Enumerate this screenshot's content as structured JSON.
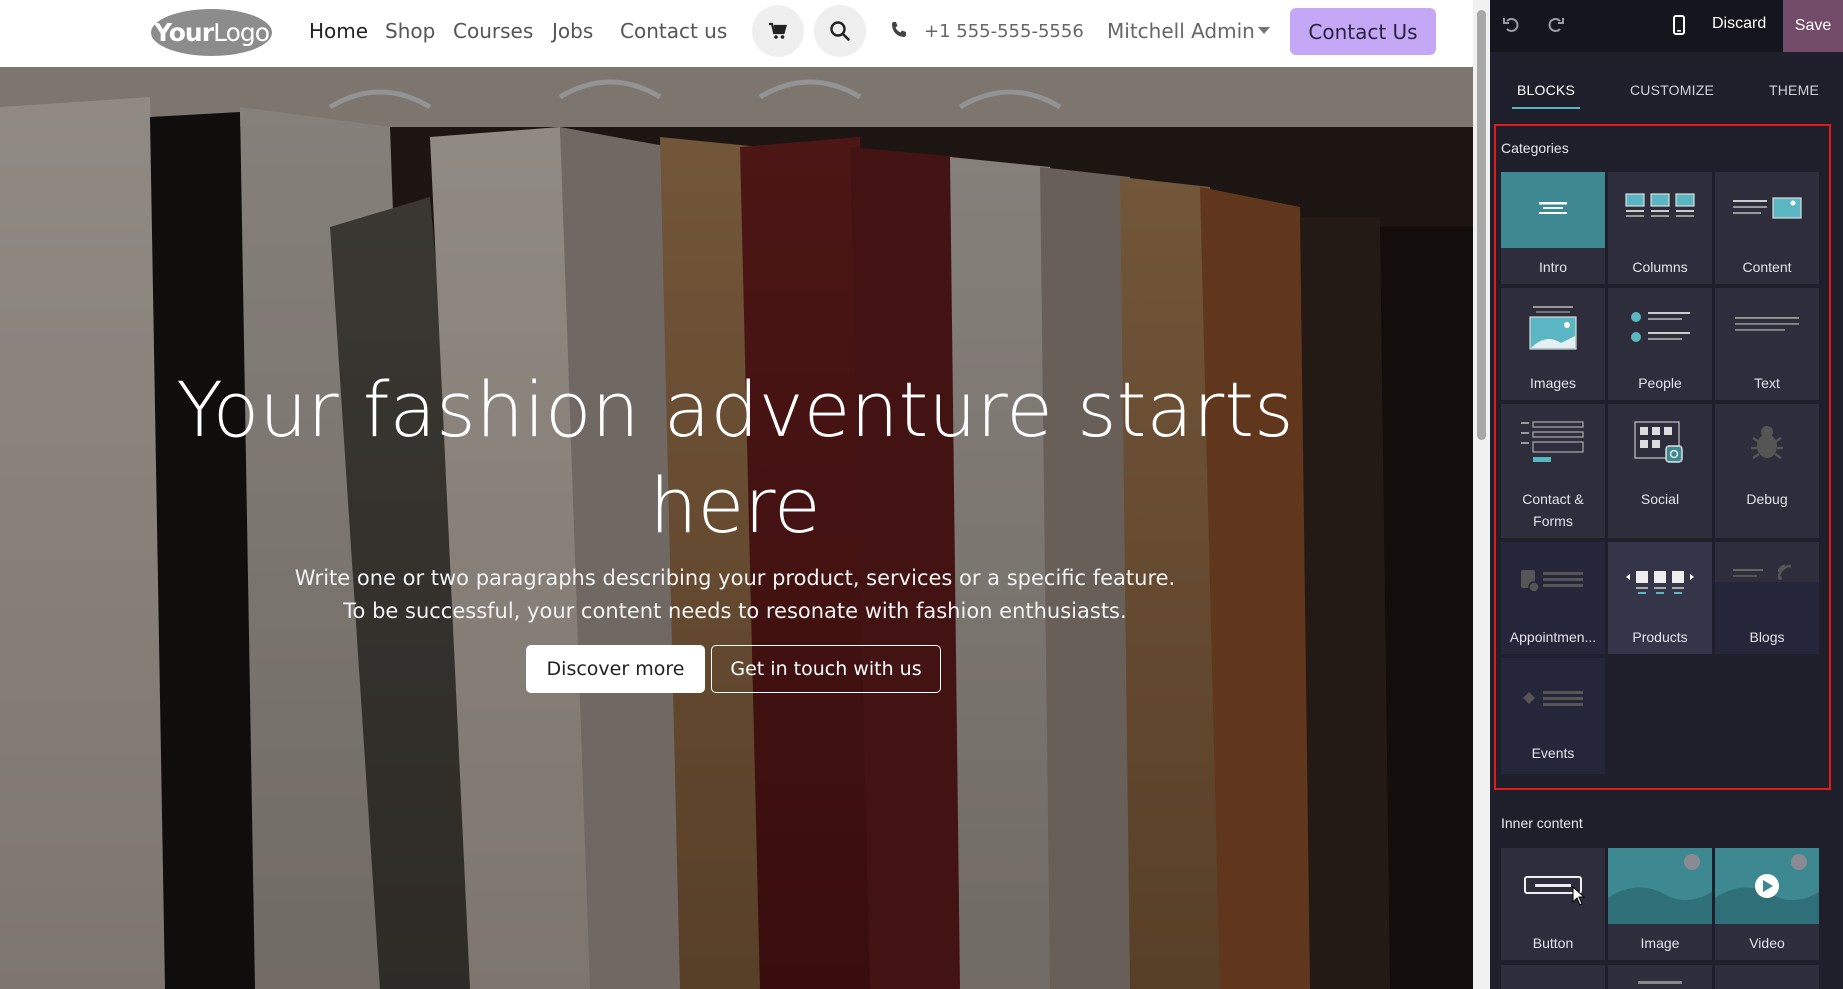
{
  "navbar": {
    "logo": {
      "bold": "Your",
      "light": "Logo"
    },
    "links": [
      "Home",
      "Shop",
      "Courses",
      "Jobs",
      "Contact us"
    ],
    "active_link": "Home",
    "phone": "+1 555-555-5556",
    "user": "Mitchell Admin",
    "cta": "Contact Us"
  },
  "hero": {
    "title": "Your fashion adventure starts here",
    "subtitle_line1": "Write one or two paragraphs describing your product, services or a specific feature.",
    "subtitle_line2": "To be successful, your content needs to resonate with fashion enthusiasts.",
    "primary_button": "Discover more",
    "secondary_button": "Get in touch with us"
  },
  "editor": {
    "discard": "Discard",
    "save": "Save",
    "tabs": [
      "BLOCKS",
      "CUSTOMIZE",
      "THEME"
    ],
    "active_tab": "BLOCKS",
    "categories_title": "Categories",
    "categories": [
      "Intro",
      "Columns",
      "Content",
      "Images",
      "People",
      "Text",
      "Contact & Forms",
      "Social",
      "Debug",
      "Appointmen...",
      "Products",
      "Blogs",
      "Events"
    ],
    "inner_title": "Inner content",
    "inner_items": [
      "Button",
      "Image",
      "Video"
    ]
  },
  "colors": {
    "cta_bg": "#c5a8f5",
    "save_bg": "#714b67",
    "accent": "#5ab6c2",
    "panel_bg": "#1f1f2b",
    "tile_bg": "#2d2d3b",
    "highlight_frame": "#e21a1a"
  }
}
